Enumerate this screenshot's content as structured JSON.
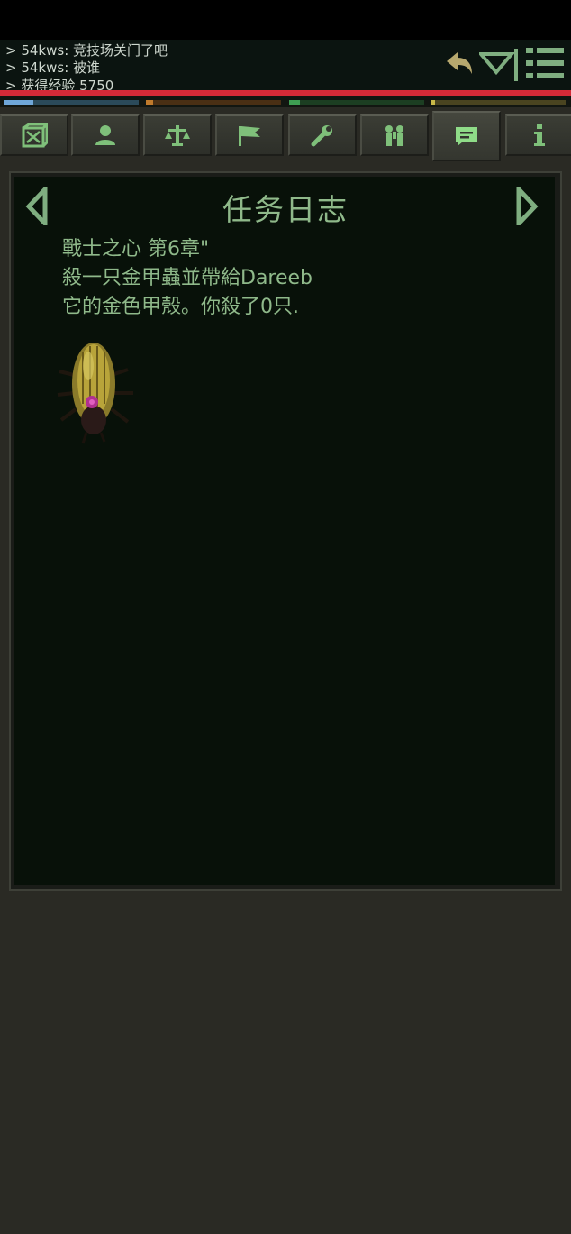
{
  "chat": {
    "lines": [
      "> 54kws: 竞技场关门了吧",
      "> 54kws: 被谁",
      "> 获得经验 5750"
    ]
  },
  "toolbar": {
    "icons": [
      "reply-icon",
      "collapse-icon",
      "menu-icon"
    ]
  },
  "meters": [
    {
      "name": "health",
      "color": "#6fa6d8",
      "fraction": 0.22
    },
    {
      "name": "mana",
      "color": "#c07a2c",
      "fraction": 0.02
    },
    {
      "name": "stamina",
      "color": "#3e9e52",
      "fraction": 0.08
    },
    {
      "name": "experience",
      "color": "#c8b848",
      "fraction": 0.02
    }
  ],
  "tabs": [
    {
      "id": "inventory",
      "icon": "box-icon"
    },
    {
      "id": "character",
      "icon": "person-icon"
    },
    {
      "id": "skills",
      "icon": "balance-icon"
    },
    {
      "id": "map",
      "icon": "flag-icon"
    },
    {
      "id": "craft",
      "icon": "wrench-icon"
    },
    {
      "id": "party",
      "icon": "group-icon"
    },
    {
      "id": "quests",
      "icon": "message-icon",
      "active": true
    },
    {
      "id": "info",
      "icon": "info-icon"
    }
  ],
  "quest_log": {
    "title": "任务日志",
    "lines": [
      "戰士之心 第6章\"",
      "殺一只金甲蟲並帶給Dareeb",
      "它的金色甲殼。你殺了0只."
    ],
    "image": "golden-beetle"
  },
  "colors": {
    "accent": "#8fb98a",
    "panel_bg": "#081109",
    "alert_bar": "#d42a37"
  }
}
